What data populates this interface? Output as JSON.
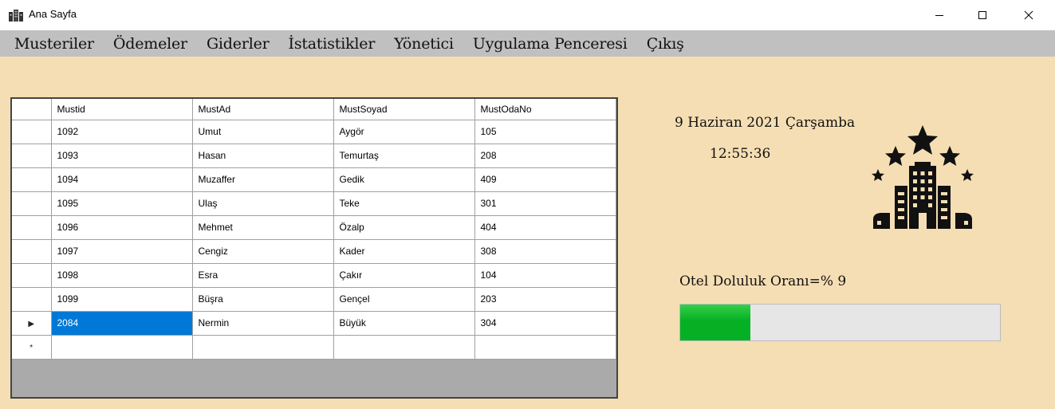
{
  "window": {
    "title": "Ana Sayfa",
    "controls": [
      "minimize",
      "maximize",
      "close"
    ]
  },
  "menu": {
    "items": [
      "Musteriler",
      "Ödemeler",
      "Giderler",
      "İstatistikler",
      "Yönetici",
      "Uygulama Penceresi",
      "Çıkış"
    ]
  },
  "grid": {
    "columns": [
      "Mustid",
      "MustAd",
      "MustSoyad",
      "MustOdaNo"
    ],
    "rows": [
      [
        "1092",
        "Umut",
        "Aygör",
        "105"
      ],
      [
        "1093",
        "Hasan",
        "Temurtaş",
        "208"
      ],
      [
        "1094",
        "Muzaffer",
        "Gedik",
        "409"
      ],
      [
        "1095",
        "Ulaş",
        "Teke",
        "301"
      ],
      [
        "1096",
        "Mehmet",
        "Özalp",
        "404"
      ],
      [
        "1097",
        "Cengiz",
        "Kader",
        "308"
      ],
      [
        "1098",
        "Esra",
        "Çakır",
        "104"
      ],
      [
        "1099",
        "Büşra",
        "Gençel",
        "203"
      ],
      [
        "2084",
        "Nermin",
        "Büyük",
        "304"
      ]
    ],
    "selected_row": 8,
    "current_row_marker": "▶",
    "new_row_marker": "*"
  },
  "info": {
    "date": "9 Haziran 2021 Çarşamba",
    "time": "12:55:36",
    "occupancy_label": "Otel Doluluk Oranı=% 9",
    "occupancy_percent": 22,
    "progress_color": "#06b025"
  },
  "icons": {
    "app": "hotel-building-icon",
    "logo": "hotel-stars-icon"
  }
}
